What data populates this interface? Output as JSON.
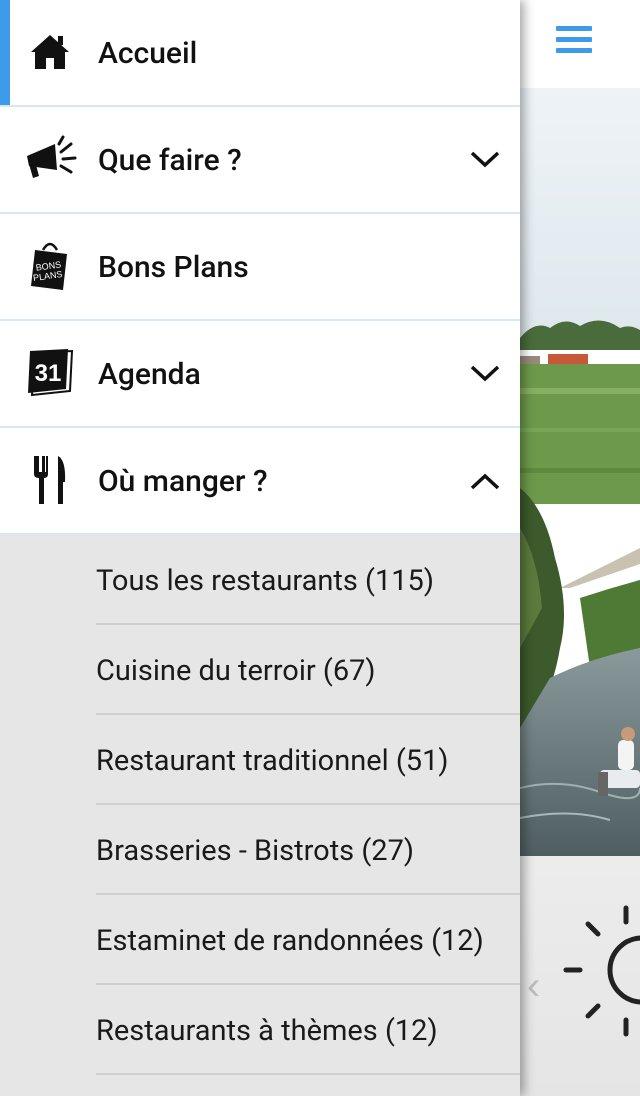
{
  "app": {
    "menu_icon": "hamburger-menu-icon",
    "accent_color": "#3d9be9",
    "weather_icon": "sun-icon",
    "carousel_prev_icon": "chevron-left-icon"
  },
  "drawer": {
    "items": [
      {
        "label": "Accueil",
        "icon": "home-icon",
        "active": true
      },
      {
        "label": "Que faire ?",
        "icon": "megaphone-icon",
        "expandable": true,
        "expanded": false
      },
      {
        "label": "Bons Plans",
        "icon": "bons-plans-bag-icon",
        "icon_text": [
          "BONS",
          "PLANS"
        ]
      },
      {
        "label": "Agenda",
        "icon": "calendar-icon",
        "icon_text": "31",
        "expandable": true,
        "expanded": false
      },
      {
        "label": "Où manger ?",
        "icon": "cutlery-icon",
        "expandable": true,
        "expanded": true
      }
    ],
    "submenu": [
      {
        "label": "Tous les restaurants (115)"
      },
      {
        "label": "Cuisine du terroir (67)"
      },
      {
        "label": "Restaurant traditionnel (51)"
      },
      {
        "label": "Brasseries - Bistrots (27)"
      },
      {
        "label": "Estaminet de randonnées (12)"
      },
      {
        "label": "Restaurants à thèmes (12)"
      }
    ]
  }
}
